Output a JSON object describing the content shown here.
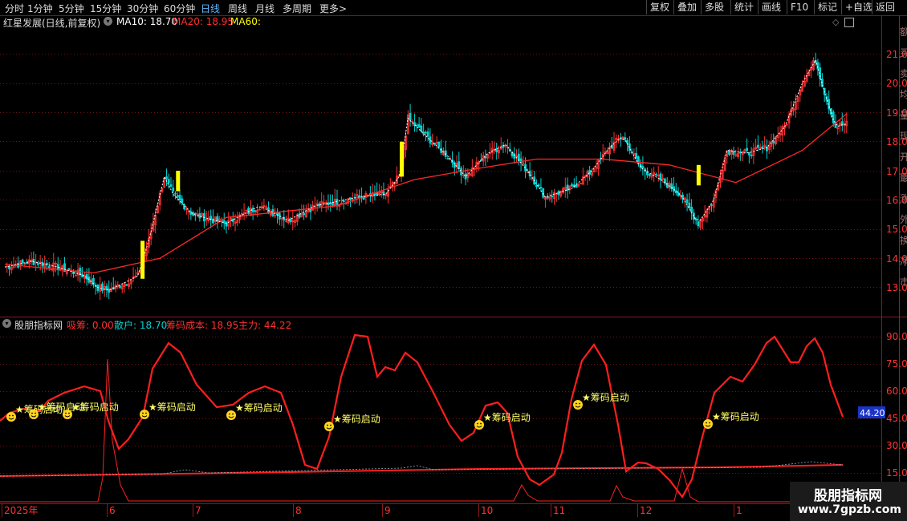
{
  "toolbar": {
    "timeframes": [
      "分时",
      "1分钟",
      "5分钟",
      "15分钟",
      "30分钟",
      "60分钟",
      "日线",
      "周线",
      "月线",
      "多周期",
      "更多"
    ],
    "active": "日线",
    "more_arrow": ">",
    "buttons": [
      "复权",
      "叠加",
      "多股",
      "统计",
      "画线",
      "F10",
      "标记",
      "+自选",
      "返回"
    ]
  },
  "main_chart": {
    "stock_name": "红星发展(日线,前复权)",
    "ma10": "MA10: 18.70",
    "ma20": "MA20: 18.95",
    "ma60": "MA60:",
    "price_axis": [
      "21.00",
      "20.00",
      "19.00",
      "18.00",
      "17.00",
      "16.00",
      "15.00",
      "14.00",
      "13.00"
    ],
    "right_side_text": [
      "额",
      "买",
      "卖",
      "均",
      "量",
      "现",
      "开",
      "最",
      "涨",
      "外",
      "换",
      "净",
      "市"
    ],
    "colors": {
      "up": "#ff3232",
      "down": "#00d2d2",
      "ma_white": "#ffffff",
      "ma_red": "#ff2828",
      "signal": "#ffff00"
    }
  },
  "indicator": {
    "name": "股朋指标网",
    "xichou": "吸筹: 0.00",
    "sanhu": "散户: 18.70",
    "chouma": "筹码成本: 18.95",
    "zhuli": "主力: 44.22",
    "axis": [
      "90.00",
      "75.00",
      "60.00",
      "45.00",
      "30.00",
      "15.00"
    ],
    "current_value": "44.20",
    "signal_label": "筹码启动",
    "signals_count": 10
  },
  "date_axis": {
    "labels": [
      "2025年",
      "6",
      "7",
      "8",
      "9",
      "10",
      "11",
      "12",
      "1"
    ]
  },
  "watermark": {
    "title": "股朋指标网",
    "url": "www.7gpzb.com"
  },
  "chart_data": {
    "type": "candlestick",
    "title": "红星发展(日线,前复权)",
    "ylim": [
      12.3,
      22.2
    ],
    "x_months": [
      "2025年",
      "6",
      "7",
      "8",
      "9",
      "10",
      "11",
      "12",
      "1"
    ],
    "approx_close_path": [
      [
        0,
        13.7
      ],
      [
        12,
        13.9
      ],
      [
        24,
        13.7
      ],
      [
        36,
        13.4
      ],
      [
        42,
        13.0
      ],
      [
        47,
        12.9
      ],
      [
        55,
        13.2
      ],
      [
        60,
        13.4
      ],
      [
        65,
        14.6
      ],
      [
        72,
        16.8
      ],
      [
        76,
        16.2
      ],
      [
        85,
        15.5
      ],
      [
        100,
        15.2
      ],
      [
        115,
        15.8
      ],
      [
        128,
        15.3
      ],
      [
        140,
        15.8
      ],
      [
        160,
        16.1
      ],
      [
        172,
        16.2
      ],
      [
        178,
        16.8
      ],
      [
        182,
        18.8
      ],
      [
        190,
        18.2
      ],
      [
        200,
        17.5
      ],
      [
        208,
        16.8
      ],
      [
        218,
        17.6
      ],
      [
        226,
        17.9
      ],
      [
        236,
        17.0
      ],
      [
        244,
        16.1
      ],
      [
        256,
        16.4
      ],
      [
        265,
        17.0
      ],
      [
        273,
        17.8
      ],
      [
        279,
        18.2
      ],
      [
        287,
        17.1
      ],
      [
        296,
        16.7
      ],
      [
        305,
        16.2
      ],
      [
        313,
        15.2
      ],
      [
        320,
        16.0
      ],
      [
        326,
        17.7
      ],
      [
        335,
        17.6
      ],
      [
        344,
        17.8
      ],
      [
        352,
        18.5
      ],
      [
        360,
        20.0
      ],
      [
        366,
        20.8
      ],
      [
        370,
        19.7
      ],
      [
        375,
        18.5
      ],
      [
        379,
        18.6
      ]
    ],
    "ma_red_path": [
      [
        0,
        13.8
      ],
      [
        40,
        13.5
      ],
      [
        70,
        14.0
      ],
      [
        100,
        15.4
      ],
      [
        150,
        15.8
      ],
      [
        185,
        16.7
      ],
      [
        215,
        17.1
      ],
      [
        240,
        17.4
      ],
      [
        270,
        17.4
      ],
      [
        300,
        17.2
      ],
      [
        330,
        16.6
      ],
      [
        360,
        17.7
      ],
      [
        380,
        18.95
      ]
    ],
    "indicator_series": {
      "name": "主力",
      "last": 44.22
    }
  }
}
